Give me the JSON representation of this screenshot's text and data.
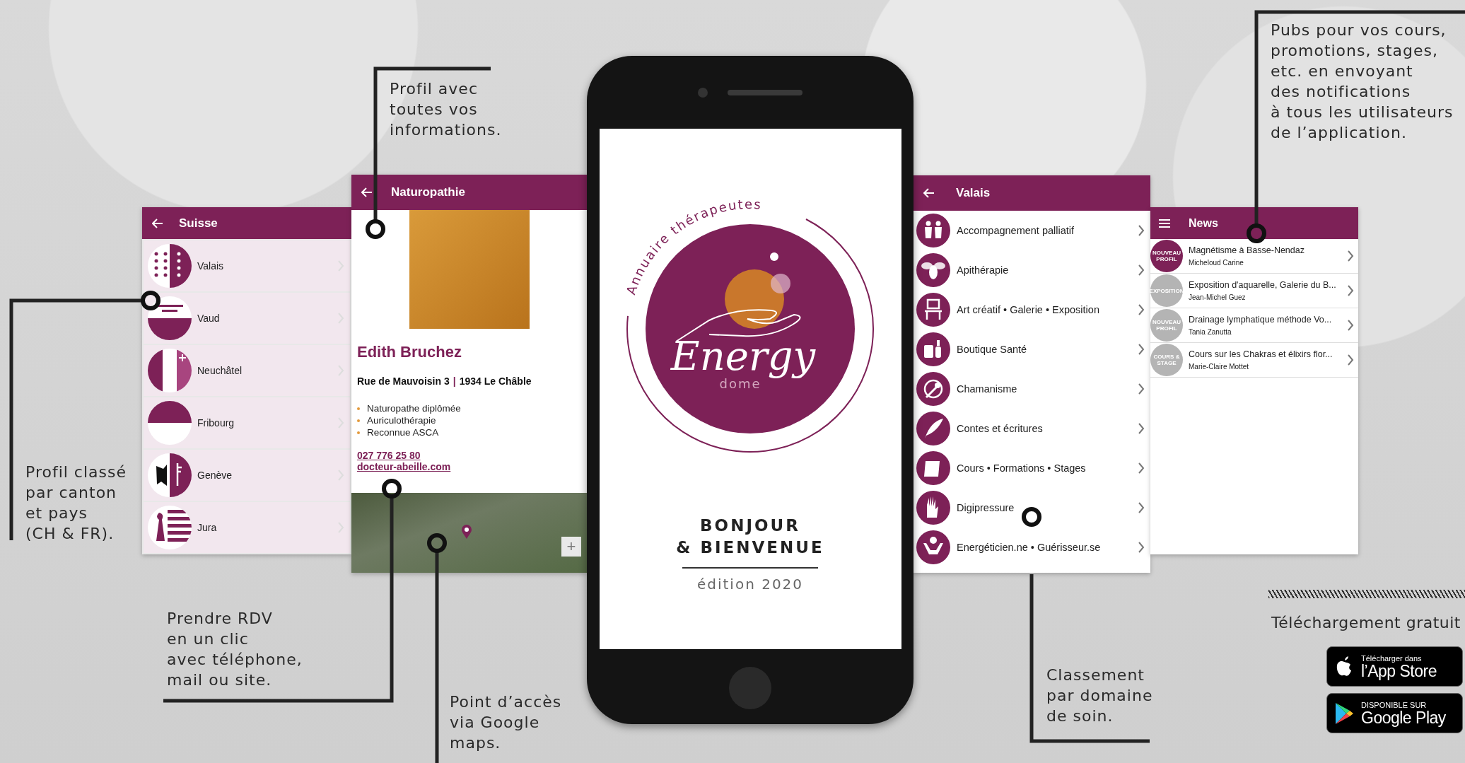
{
  "cantons_screen": {
    "title": "Suisse",
    "items": [
      {
        "name": "Valais"
      },
      {
        "name": "Vaud"
      },
      {
        "name": "Neuchâtel"
      },
      {
        "name": "Fribourg"
      },
      {
        "name": "Genève"
      },
      {
        "name": "Jura"
      }
    ]
  },
  "profile_screen": {
    "title": "Naturopathie",
    "name": "Edith Bruchez",
    "street": "Rue de Mauvoisin 3",
    "separator": "|",
    "city": "1934 Le Châble",
    "qualifications": [
      "Naturopathe diplômée",
      "Auriculothérapie",
      "Reconnue ASCA"
    ],
    "phone": "027 776 25 80",
    "website": "docteur-abeille.com",
    "map_zoom_button": "+"
  },
  "splash_screen": {
    "tagline": "Annuaire thérapeutes",
    "brand": "Energy",
    "brand_sub": "dome",
    "greeting": "BONJOUR\n& BIENVENUE",
    "edition": "édition 2020"
  },
  "categories_screen": {
    "title": "Valais",
    "items": [
      {
        "name": "Accompagnement palliatif"
      },
      {
        "name": "Apithérapie"
      },
      {
        "name": "Art créatif • Galerie • Exposition"
      },
      {
        "name": "Boutique Santé"
      },
      {
        "name": "Chamanisme"
      },
      {
        "name": "Contes et écritures"
      },
      {
        "name": "Cours • Formations • Stages"
      },
      {
        "name": "Digipressure"
      },
      {
        "name": "Energéticien.ne • Guérisseur.se"
      }
    ]
  },
  "news_screen": {
    "title": "News",
    "items": [
      {
        "badge": "NOUVEAU PROFIL",
        "color": "#7d2157",
        "title": "Magnétisme à Basse-Nendaz",
        "author": "Micheloud Carine"
      },
      {
        "badge": "EXPOSITION",
        "color": "#b4b4b4",
        "title": "Exposition d'aquarelle, Galerie du B...",
        "author": "Jean-Michel Guez"
      },
      {
        "badge": "NOUVEAU PROFIL",
        "color": "#b4b4b4",
        "title": "Drainage lymphatique méthode Vo...",
        "author": "Tania Zanutta"
      },
      {
        "badge": "COURS & STAGE",
        "color": "#b4b4b4",
        "title": "Cours sur les Chakras et élixirs flor...",
        "author": "Marie-Claire Mottet"
      }
    ]
  },
  "callouts": [
    "Profil avec\ntoutes vos\ninformations.",
    "Pubs pour vos cours,\npromotions, stages,\netc. en envoyant\ndes notifications\nà tous les utilisateurs\nde l’application.",
    "Profil classé\npar canton\net pays\n(CH & FR).",
    "Prendre RDV\nen un clic\navec téléphone,\nmail ou site.",
    "Point d’accès\nvia Google\nmaps.",
    "Classement\npar domaine\nde soin."
  ],
  "download": {
    "label": "Téléchargement gratuit",
    "badges": [
      {
        "kind": "apple",
        "caption": "Télécharger dans",
        "store": "l’App Store"
      },
      {
        "kind": "google",
        "caption": "DISPONIBLE SUR",
        "store": "Google Play"
      }
    ]
  }
}
